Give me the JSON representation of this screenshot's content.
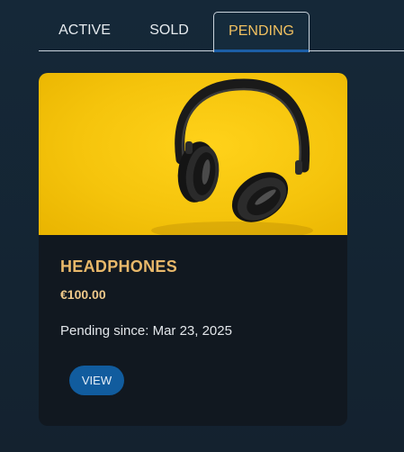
{
  "tabs": [
    {
      "label": "ACTIVE"
    },
    {
      "label": "SOLD"
    },
    {
      "label": "PENDING"
    }
  ],
  "active_tab": "PENDING",
  "colors": {
    "background": "#152838",
    "active_tab_text": "#f0c060",
    "card_background": "#111820",
    "title": "#e8b86a",
    "button": "#115c9e"
  },
  "card": {
    "image_subject": "headphones on yellow background",
    "title": "HEADPHONES",
    "price": "€100.00",
    "status": "Pending since: Mar 23, 2025",
    "view_label": "VIEW"
  }
}
